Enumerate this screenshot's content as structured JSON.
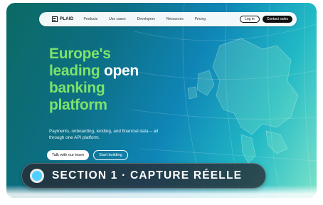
{
  "nav": {
    "logo_text": "PLAID",
    "links": [
      "Products",
      "Use cases",
      "Developers",
      "Resources",
      "Pricing"
    ],
    "login_label": "Log in",
    "contact_label": "Contact sales"
  },
  "hero": {
    "headline_line1": "Europe's",
    "headline_line2a": "leading",
    "headline_line2b": "open",
    "headline_line3": "banking",
    "headline_line4": "platform",
    "subtext": "Payments, onboarding, lending, and financial data – all through one API platform.",
    "primary_cta": "Talk with our team",
    "secondary_cta": "Start building"
  },
  "overlay": {
    "section_label": "SECTION 1 · CAPTURE RÉELLE"
  },
  "colors": {
    "accent_green": "#7de36a",
    "badge_dot": "#4fd0ff"
  }
}
